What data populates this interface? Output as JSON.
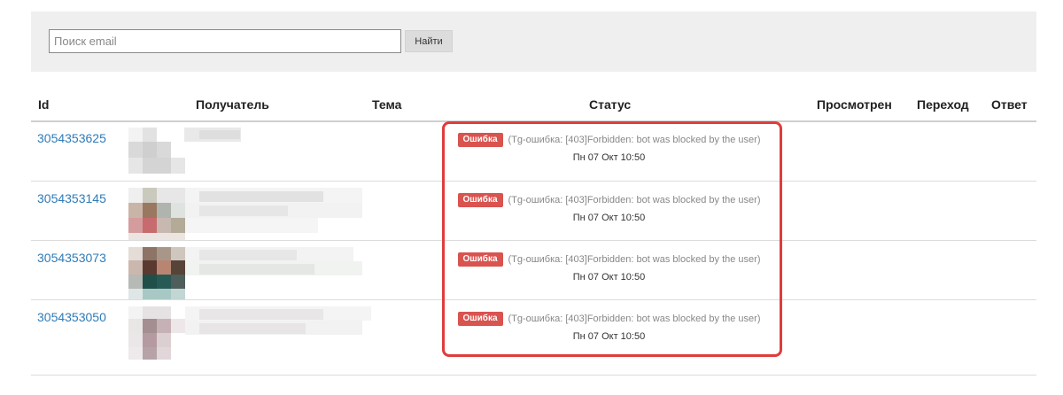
{
  "search": {
    "placeholder": "Поиск email",
    "value": "",
    "button_label": "Найти"
  },
  "table": {
    "headers": {
      "id": "Id",
      "recipient": "Получатель",
      "subject": "Тема",
      "status": "Статус",
      "viewed": "Просмотрен",
      "click": "Переход",
      "reply": "Ответ"
    },
    "rows": [
      {
        "id": "3054353625",
        "status_badge": "Ошибка",
        "status_message": "(Tg-ошибка: [403]Forbidden: bot was blocked by the user)",
        "status_time": "Пн 07 Окт 10:50"
      },
      {
        "id": "3054353145",
        "status_badge": "Ошибка",
        "status_message": "(Tg-ошибка: [403]Forbidden: bot was blocked by the user)",
        "status_time": "Пн 07 Окт 10:50"
      },
      {
        "id": "3054353073",
        "status_badge": "Ошибка",
        "status_message": "(Tg-ошибка: [403]Forbidden: bot was blocked by the user)",
        "status_time": "Пн 07 Окт 10:50"
      },
      {
        "id": "3054353050",
        "status_badge": "Ошибка",
        "status_message": "(Tg-ошибка: [403]Forbidden: bot was blocked by the user)",
        "status_time": "Пн 07 Окт 10:50"
      }
    ]
  },
  "colors": {
    "error_badge": "#d9534f",
    "link": "#2f7bb8",
    "highlight_border": "#e03c3c"
  }
}
